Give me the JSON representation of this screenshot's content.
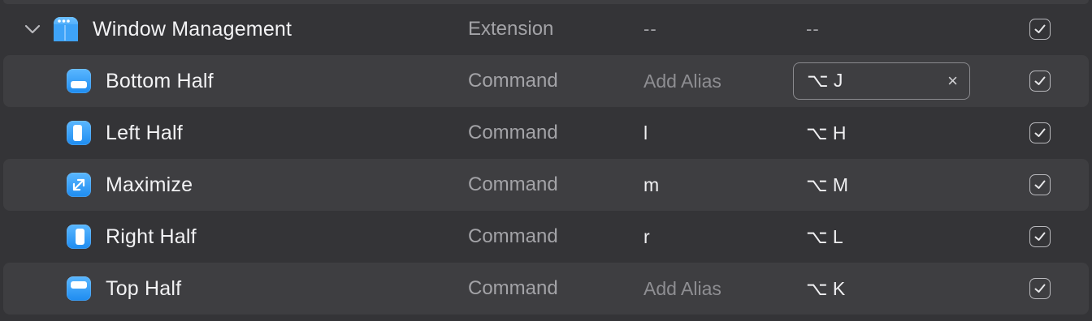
{
  "colors": {
    "background": "#343437",
    "row_alt": "#3e3e41",
    "icon_blue": "#1e8cf0",
    "secondary_text": "#a3a3a7",
    "placeholder_text": "#8e8e92"
  },
  "extension": {
    "name": "Window Management",
    "type": "Extension",
    "alias": "--",
    "hotkey": "--",
    "icon": "window-management-icon",
    "enabled": true,
    "expanded": true
  },
  "commands": [
    {
      "name": "Bottom Half",
      "type": "Command",
      "alias": "Add Alias",
      "alias_is_placeholder": true,
      "hotkey": "⌥ J",
      "editing_hotkey": true,
      "icon": "bottom-half-icon",
      "enabled": true
    },
    {
      "name": "Left Half",
      "type": "Command",
      "alias": "l",
      "alias_is_placeholder": false,
      "hotkey": "⌥ H",
      "icon": "left-half-icon",
      "enabled": true
    },
    {
      "name": "Maximize",
      "type": "Command",
      "alias": "m",
      "alias_is_placeholder": false,
      "hotkey": "⌥ M",
      "icon": "maximize-icon",
      "enabled": true
    },
    {
      "name": "Right Half",
      "type": "Command",
      "alias": "r",
      "alias_is_placeholder": false,
      "hotkey": "⌥ L",
      "icon": "right-half-icon",
      "enabled": true
    },
    {
      "name": "Top Half",
      "type": "Command",
      "alias": "Add Alias",
      "alias_is_placeholder": true,
      "hotkey": "⌥ K",
      "icon": "top-half-icon",
      "enabled": true
    }
  ],
  "hotkey_clear_glyph": "×"
}
